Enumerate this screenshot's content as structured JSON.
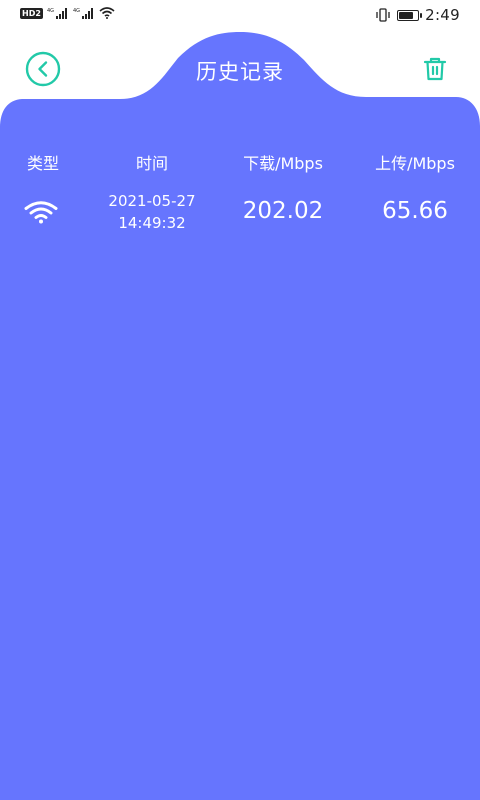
{
  "status_bar": {
    "hd": "HD",
    "hd_sub": "2",
    "sim1": "4G",
    "sim2": "4G",
    "time": "2:49",
    "battery_level": 0.7
  },
  "header": {
    "title": "历史记录",
    "back_icon": "back-chevron-icon",
    "delete_icon": "trash-icon"
  },
  "colors": {
    "panel": "#6675FE",
    "accent": "#22C9A8",
    "text_on_panel": "#FFFFFF"
  },
  "table": {
    "columns": [
      "类型",
      "时间",
      "下载/Mbps",
      "上传/Mbps"
    ],
    "rows": [
      {
        "type_icon": "wifi-icon",
        "date": "2021-05-27",
        "time": "14:49:32",
        "download": "202.02",
        "upload": "65.66"
      }
    ]
  }
}
